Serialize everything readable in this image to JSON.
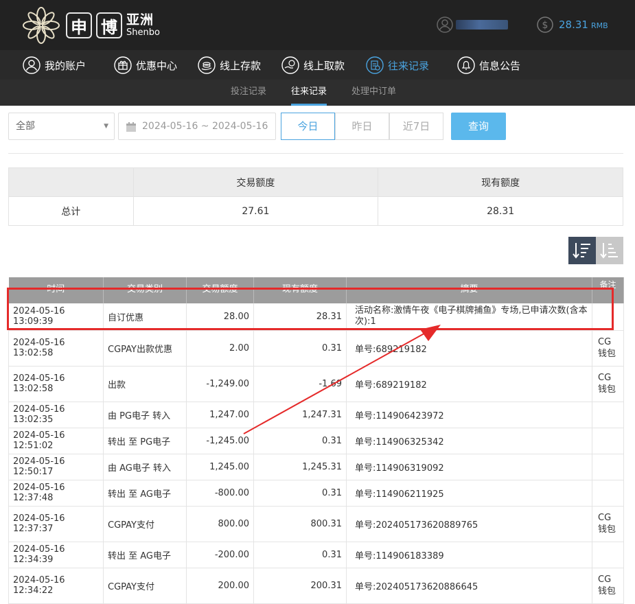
{
  "brand": {
    "name_cn": "亚洲",
    "char1": "申",
    "char2": "博",
    "en": "Shenbo"
  },
  "header": {
    "balance": "28.31",
    "currency": "RMB"
  },
  "nav": [
    {
      "label": "我的账户",
      "icon": "user-icon"
    },
    {
      "label": "优惠中心",
      "icon": "gift-icon"
    },
    {
      "label": "线上存款",
      "icon": "deposit-icon"
    },
    {
      "label": "线上取款",
      "icon": "withdraw-icon"
    },
    {
      "label": "往来记录",
      "icon": "records-icon",
      "active": true
    },
    {
      "label": "信息公告",
      "icon": "bell-icon"
    }
  ],
  "subnav": [
    {
      "label": "投注记录"
    },
    {
      "label": "往来记录",
      "active": true
    },
    {
      "label": "处理中订单"
    }
  ],
  "filter": {
    "type_value": "全部",
    "date_range": "2024-05-16 ~ 2024-05-16",
    "quick": [
      "今日",
      "昨日",
      "近7日"
    ],
    "search_label": "查询"
  },
  "summary": {
    "headers": [
      "",
      "交易额度",
      "现有额度"
    ],
    "row": [
      "总计",
      "27.61",
      "28.31"
    ]
  },
  "table": {
    "headers": [
      "时间",
      "交易类别",
      "交易额度",
      "现有额度",
      "摘要",
      "备注"
    ],
    "rows": [
      [
        "2024-05-16 13:09:39",
        "自订优惠",
        "28.00",
        "28.31",
        "活动名称:激情午夜《电子棋牌捕鱼》专场,已申请次数(含本次):1",
        ""
      ],
      [
        "2024-05-16 13:02:58",
        "CGPAY出款优惠",
        "2.00",
        "0.31",
        "单号:689219182",
        "CG钱包"
      ],
      [
        "2024-05-16 13:02:58",
        "出款",
        "-1,249.00",
        "-1.69",
        "单号:689219182",
        "CG钱包"
      ],
      [
        "2024-05-16 13:02:35",
        "由 PG电子 转入",
        "1,247.00",
        "1,247.31",
        "单号:114906423972",
        ""
      ],
      [
        "2024-05-16 12:51:02",
        "转出 至 PG电子",
        "-1,245.00",
        "0.31",
        "单号:114906325342",
        ""
      ],
      [
        "2024-05-16 12:50:17",
        "由 AG电子 转入",
        "1,245.00",
        "1,245.31",
        "单号:114906319092",
        ""
      ],
      [
        "2024-05-16 12:37:48",
        "转出 至 AG电子",
        "-800.00",
        "0.31",
        "单号:114906211925",
        ""
      ],
      [
        "2024-05-16 12:37:37",
        "CGPAY支付",
        "800.00",
        "800.31",
        "单号:202405173620889765",
        "CG钱包"
      ],
      [
        "2024-05-16 12:34:39",
        "转出 至 AG电子",
        "-200.00",
        "0.31",
        "单号:114906183389",
        ""
      ],
      [
        "2024-05-16 12:34:22",
        "CGPAY支付",
        "200.00",
        "200.31",
        "单号:202405173620886645",
        "CG钱包"
      ]
    ]
  },
  "colors": {
    "accent": "#4aa3df",
    "annotation": "#e52a2a",
    "header_bg": "#222222"
  }
}
